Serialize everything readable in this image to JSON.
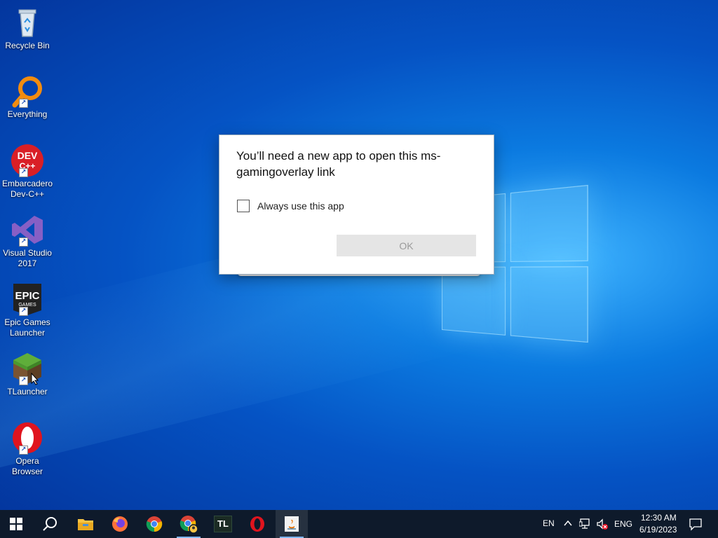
{
  "desktop": {
    "icons": [
      {
        "name": "Recycle Bin"
      },
      {
        "name": "Everything"
      },
      {
        "name": "Embarcadero Dev-C++"
      },
      {
        "name": "Visual Studio 2017"
      },
      {
        "name": "Epic Games Launcher"
      },
      {
        "name": "TLauncher"
      },
      {
        "name": "Opera Browser"
      }
    ],
    "icon_glyphs": {
      "devcpp": "DEV C++",
      "epic": "EPIC",
      "epic_sub": "GAMES"
    }
  },
  "dialog": {
    "title": "You’ll need a new app to open this ms-gamingoverlay link",
    "checkbox_label": "Always use this app",
    "checkbox_checked": false,
    "ok_label": "OK",
    "ok_enabled": false
  },
  "taskbar": {
    "pinned": [
      {
        "icon": "windows-start-icon"
      },
      {
        "icon": "search-icon"
      },
      {
        "icon": "file-explorer-icon"
      },
      {
        "icon": "firefox-icon"
      },
      {
        "icon": "chrome-icon"
      },
      {
        "icon": "chrome-profile-icon"
      },
      {
        "icon": "tlauncher-icon",
        "text": "TL"
      },
      {
        "icon": "opera-icon"
      },
      {
        "icon": "java-icon"
      }
    ],
    "tray": {
      "lang_short": "EN",
      "lang": "ENG",
      "time": "12:30 AM",
      "date": "6/19/2023"
    }
  },
  "colors": {
    "taskbar": "#0e1a2b",
    "accent": "#0078d7"
  }
}
